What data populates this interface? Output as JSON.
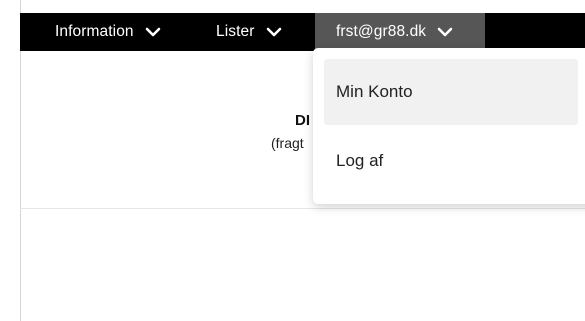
{
  "nav": {
    "information_label": "Information",
    "lister_label": "Lister",
    "account_label": "frst@gr88.dk"
  },
  "hero": {
    "title_fragment": "DI",
    "subtitle_fragment": "(fragt"
  },
  "account_menu": {
    "items": [
      {
        "label": "Min Konto"
      },
      {
        "label": "Log af"
      }
    ]
  },
  "icons": {
    "chevron": "chevron-down-icon"
  },
  "colors": {
    "navbar_bg": "#000000",
    "account_active_bg": "#565656",
    "menu_hover_bg": "#f1f1f1"
  }
}
